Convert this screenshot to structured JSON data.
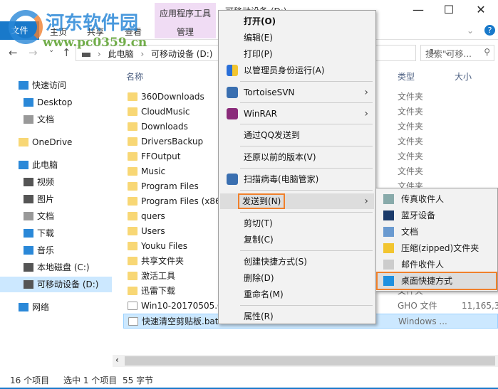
{
  "window": {
    "ribbon_tool": "应用程序工具",
    "ribbon_tool_tab": "管理",
    "title": "可移动设备 (D:)",
    "minimize": "—",
    "maximize": "☐",
    "close": "✕"
  },
  "tabs": [
    "文件",
    "主页",
    "共享",
    "查看"
  ],
  "address": {
    "path": [
      "此电脑",
      "可移动设备 (D:)"
    ],
    "search_placeholder": "搜索\"可移...",
    "search_icon": "search-icon"
  },
  "sidebar": [
    {
      "label": "快速访问",
      "icon": "star-icon",
      "color": "#2a88d8"
    },
    {
      "label": "Desktop",
      "icon": "desktop-icon",
      "color": "#2a88d8"
    },
    {
      "label": "文档",
      "icon": "document-icon",
      "color": "#999999"
    },
    {
      "label": "OneDrive",
      "icon": "folder-icon",
      "color": "#f8d775"
    },
    {
      "label": "此电脑",
      "icon": "computer-icon",
      "color": "#2a88d8"
    },
    {
      "label": "视频",
      "icon": "video-icon",
      "color": "#555555"
    },
    {
      "label": "图片",
      "icon": "picture-icon",
      "color": "#555555"
    },
    {
      "label": "文档",
      "icon": "document-icon",
      "color": "#999999"
    },
    {
      "label": "下载",
      "icon": "download-icon",
      "color": "#2a88d8"
    },
    {
      "label": "音乐",
      "icon": "music-icon",
      "color": "#2a88d8"
    },
    {
      "label": "本地磁盘 (C:)",
      "icon": "drive-icon",
      "color": "#555555"
    },
    {
      "label": "可移动设备 (D:)",
      "icon": "usb-drive-icon",
      "color": "#555555",
      "selected": true
    },
    {
      "label": "网络",
      "icon": "network-icon",
      "color": "#2a88d8"
    }
  ],
  "columns": {
    "name": "名称",
    "type": "类型",
    "size": "大小"
  },
  "files": [
    {
      "name": "360Downloads",
      "type": "文件夹",
      "size": ""
    },
    {
      "name": "CloudMusic",
      "type": "文件夹",
      "size": ""
    },
    {
      "name": "Downloads",
      "type": "文件夹",
      "size": ""
    },
    {
      "name": "DriversBackup",
      "type": "文件夹",
      "size": ""
    },
    {
      "name": "FFOutput",
      "type": "文件夹",
      "size": ""
    },
    {
      "name": "Music",
      "type": "文件夹",
      "size": ""
    },
    {
      "name": "Program Files",
      "type": "文件夹",
      "size": ""
    },
    {
      "name": "Program Files (x86",
      "type": "文件夹",
      "size": ""
    },
    {
      "name": "quers",
      "type": "文件夹",
      "size": ""
    },
    {
      "name": "Users",
      "type": "文件夹",
      "size": ""
    },
    {
      "name": "Youku Files",
      "type": "文件夹",
      "size": ""
    },
    {
      "name": "共享文件夹",
      "type": "文件夹",
      "size": ""
    },
    {
      "name": "激活工具",
      "type": "文件夹",
      "size": ""
    },
    {
      "name": "迅雷下载",
      "type": "文件夹",
      "size": ""
    },
    {
      "name": "Win10-20170505.G",
      "type": "GHO 文件",
      "size": "11,165,32"
    },
    {
      "name": "快速清空剪贴板.bat",
      "type": "Windows ...",
      "size": "",
      "selected": true
    }
  ],
  "status": {
    "count": "16 个项目",
    "selected": "选中 1 个项目",
    "size": "55 字节"
  },
  "context_menu": [
    {
      "label": "打开(O)",
      "bold": true
    },
    {
      "label": "编辑(E)"
    },
    {
      "label": "打印(P)"
    },
    {
      "label": "以管理员身份运行(A)",
      "icon": "shield-icon"
    },
    {
      "sep": true
    },
    {
      "label": "TortoiseSVN",
      "icon": "tortoisesvn-icon",
      "submenu": true
    },
    {
      "sep": true
    },
    {
      "label": "WinRAR",
      "icon": "winrar-icon",
      "submenu": true
    },
    {
      "sep": true
    },
    {
      "label": "通过QQ发送到"
    },
    {
      "sep": true
    },
    {
      "label": "还原以前的版本(V)"
    },
    {
      "sep": true
    },
    {
      "label": "扫描病毒(电脑管家)",
      "icon": "antivirus-icon"
    },
    {
      "sep": true
    },
    {
      "label": "发送到(N)",
      "submenu": true,
      "highlighted": true
    },
    {
      "sep": true
    },
    {
      "label": "剪切(T)"
    },
    {
      "label": "复制(C)"
    },
    {
      "sep": true
    },
    {
      "label": "创建快捷方式(S)"
    },
    {
      "label": "删除(D)"
    },
    {
      "label": "重命名(M)"
    },
    {
      "sep": true
    },
    {
      "label": "属性(R)"
    }
  ],
  "send_to": [
    {
      "label": "传真收件人",
      "icon": "fax-icon"
    },
    {
      "label": "蓝牙设备",
      "icon": "bluetooth-icon"
    },
    {
      "label": "文档",
      "icon": "document-icon"
    },
    {
      "label": "压缩(zipped)文件夹",
      "icon": "zip-folder-icon"
    },
    {
      "label": "邮件收件人",
      "icon": "mail-icon"
    },
    {
      "label": "桌面快捷方式",
      "icon": "desktop-shortcut-icon",
      "highlighted": true
    }
  ],
  "watermark": {
    "name": "河东软件园",
    "url": "www.pc0359.cn"
  },
  "accent": "#f0802b"
}
